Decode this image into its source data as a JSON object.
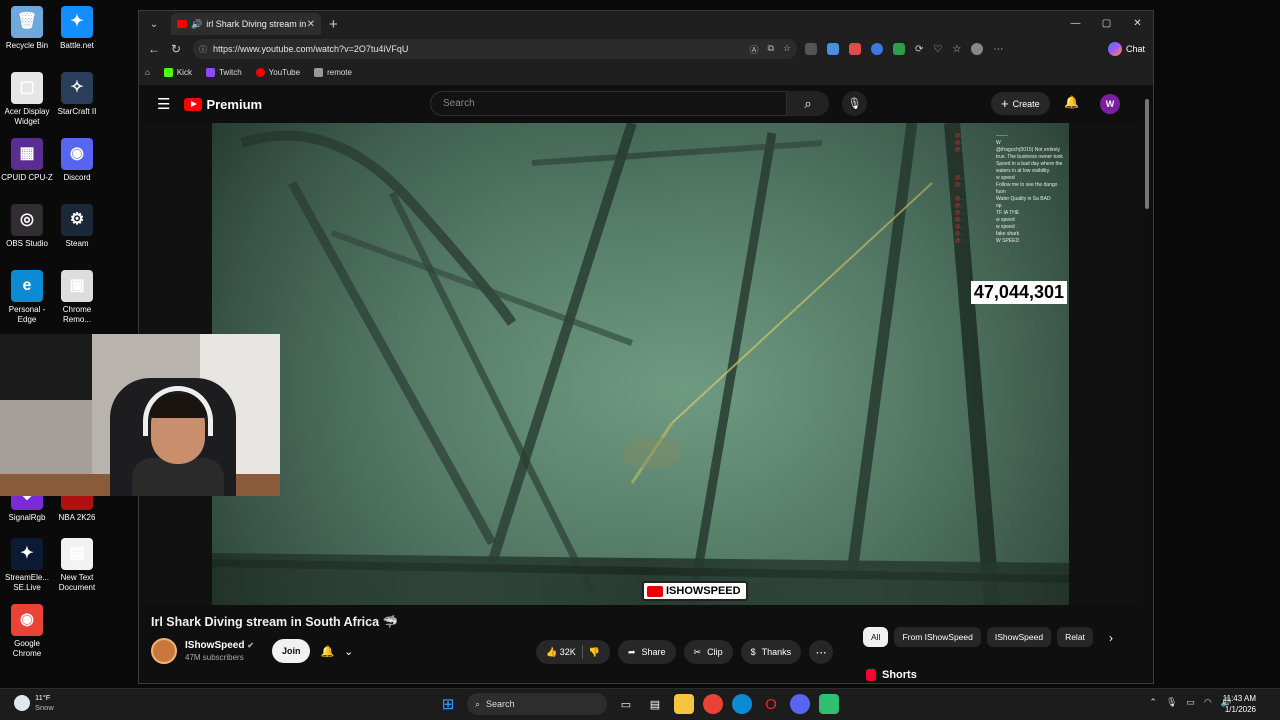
{
  "desktop": {
    "icons": [
      {
        "label": "Recycle Bin",
        "color": "#6fa8dc",
        "glyph": "🗑"
      },
      {
        "label": "Battle.net",
        "color": "#148eff",
        "glyph": "✦"
      },
      {
        "label": "Acer Display Widget",
        "color": "#e6e6e6",
        "glyph": "▢"
      },
      {
        "label": "StarCraft II",
        "color": "#2a3d5a",
        "glyph": "✧"
      },
      {
        "label": "CPUID CPU-Z",
        "color": "#5a2d91",
        "glyph": "▦"
      },
      {
        "label": "Discord",
        "color": "#5865f2",
        "glyph": "◉"
      },
      {
        "label": "OBS Studio",
        "color": "#302e31",
        "glyph": "◎"
      },
      {
        "label": "Steam",
        "color": "#1b2838",
        "glyph": "⚙"
      },
      {
        "label": "Personal - Edge",
        "color": "#0c8bd4",
        "glyph": "e"
      },
      {
        "label": "Chrome Remo...",
        "color": "#dddddd",
        "glyph": "▣"
      },
      {
        "label": "SignalRgb",
        "color": "#7a2bd8",
        "glyph": "◆"
      },
      {
        "label": "NBA 2K26",
        "color": "#b01010",
        "glyph": "▪"
      },
      {
        "label": "StreamEle... SE.Live",
        "color": "#0c1b33",
        "glyph": "✦"
      },
      {
        "label": "New Text Document",
        "color": "#f2f2f2",
        "glyph": "▤"
      },
      {
        "label": "Google Chrome",
        "color": "#ea4335",
        "glyph": "◉"
      }
    ]
  },
  "browser": {
    "tab_title": "irl Shark Diving stream in Sout",
    "url": "https://www.youtube.com/watch?v=2O7tu4iVFqU",
    "copilot_label": "Chat",
    "favorites": [
      "Kick",
      "Twitch",
      "YouTube",
      "remote"
    ],
    "favorite_colors": [
      "#53fc18",
      "#9146ff",
      "#ff0000",
      "#999999"
    ]
  },
  "youtube": {
    "logo_text": "Premium",
    "search_placeholder": "Search",
    "create_label": "Create",
    "avatar_letter": "W",
    "video": {
      "view_counter": "47,044,301",
      "watermark": "ISHOWSPEED",
      "chat_lines": [
        {
          "user": "@...",
          "msg": "-------"
        },
        {
          "user": "@...",
          "msg": "W"
        },
        {
          "user": "@...",
          "msg": "@ifragoch(0015) Not entirely true. The business owner took Speed in a bad day where the waters in at low visibility."
        },
        {
          "user": "@...",
          "msg": "w speed"
        },
        {
          "user": "@...",
          "msg": "Follow me to see the dango fuon"
        },
        {
          "user": "@...",
          "msg": "Water Quality in Sa BAD"
        },
        {
          "user": "@...",
          "msg": "op"
        },
        {
          "user": "@...",
          "msg": "TF IA THE"
        },
        {
          "user": "@...",
          "msg": "w speed"
        },
        {
          "user": "@...",
          "msg": "w speed"
        },
        {
          "user": "@...",
          "msg": "fake shark"
        },
        {
          "user": "@...",
          "msg": "W SPEED"
        }
      ]
    },
    "title": "Irl Shark Diving stream in South Africa 🦈",
    "channel": {
      "name": "IShowSpeed",
      "subscribers": "47M subscribers",
      "join_label": "Join"
    },
    "actions": {
      "likes": "32K",
      "share": "Share",
      "clip": "Clip",
      "thanks": "Thanks"
    },
    "chips": [
      "All",
      "From IShowSpeed",
      "IShowSpeed",
      "Relat"
    ],
    "shorts_label": "Shorts"
  },
  "taskbar": {
    "temperature": "11°F",
    "condition": "Snow",
    "search_label": "Search",
    "time": "11:43 AM",
    "date": "1/1/2026"
  }
}
